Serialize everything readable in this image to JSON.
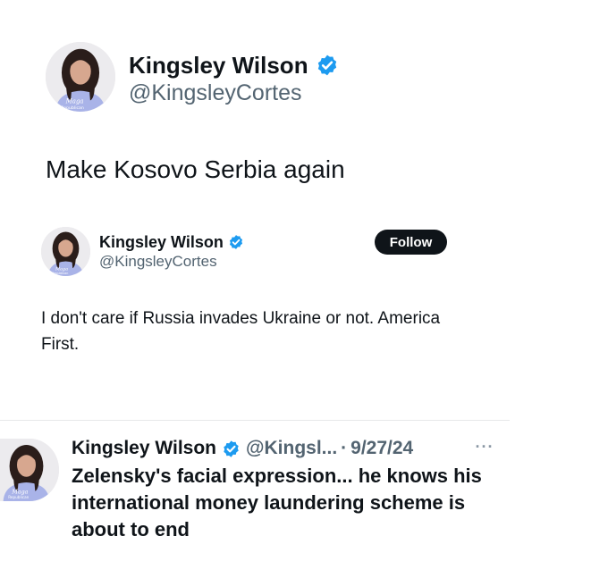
{
  "colors": {
    "verified_blue": "#1d9bf0",
    "text_primary": "#0f1419",
    "text_secondary": "#536471",
    "follow_bg": "#0f1419",
    "divider": "#e7e9ea"
  },
  "tweet_large": {
    "display_name": "Kingsley Wilson",
    "handle": "@KingsleyCortes",
    "text": "Make Kosovo Serbia again",
    "avatar_shirt_text": "Maga Republican",
    "verified_icon": "verified-badge-icon"
  },
  "tweet_medium": {
    "display_name": "Kingsley Wilson",
    "handle": "@KingsleyCortes",
    "follow_label": "Follow",
    "text": "I don't care if Russia invades Ukraine or not. America First.",
    "avatar_shirt_text": "Maga Republican",
    "verified_icon": "verified-badge-icon"
  },
  "tweet_small": {
    "display_name": "Kingsley Wilson",
    "handle": "@Kingsl...",
    "separator": "·",
    "date": "9/27/24",
    "more_label": "···",
    "text": "Zelensky's facial expression... he knows his international money laundering scheme is about to end",
    "avatar_shirt_text": "Maga Republican",
    "verified_icon": "verified-badge-icon"
  }
}
